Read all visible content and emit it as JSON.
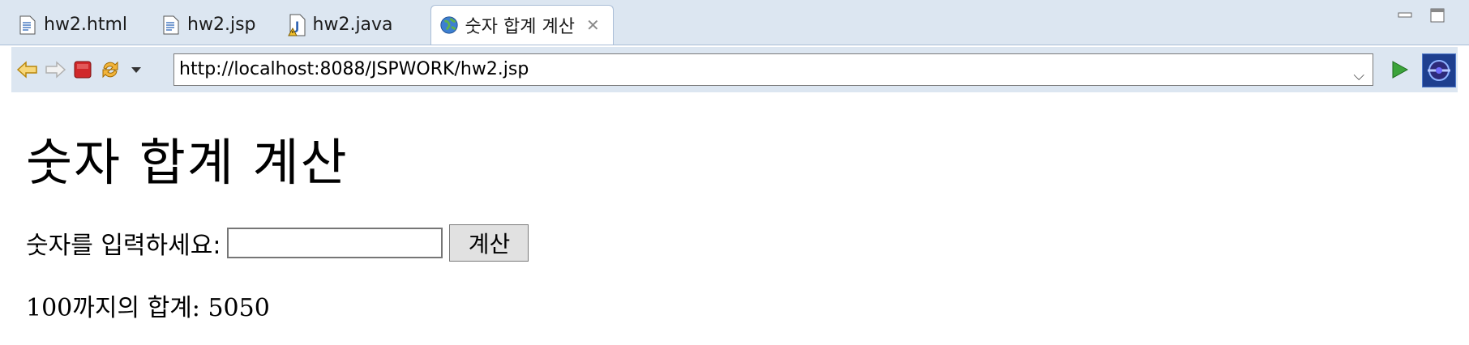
{
  "tabs": [
    {
      "label": "hw2.html",
      "icon": "html-file-icon"
    },
    {
      "label": "hw2.jsp",
      "icon": "jsp-file-icon"
    },
    {
      "label": "hw2.java",
      "icon": "java-file-warning-icon"
    },
    {
      "label": "숫자 합계 계산",
      "icon": "globe-icon",
      "active": true
    }
  ],
  "toolbar": {
    "url": "http://localhost:8088/JSPWORK/hw2.jsp"
  },
  "page": {
    "heading": "숫자 합계 계산",
    "prompt_label": "숫자를 입력하세요:",
    "input_value": "",
    "button_label": "계산",
    "result": "100까지의 합계: 5050"
  },
  "colors": {
    "chrome": "#dce6f1",
    "go": "#3ba33b",
    "stop": "#d0282a"
  }
}
